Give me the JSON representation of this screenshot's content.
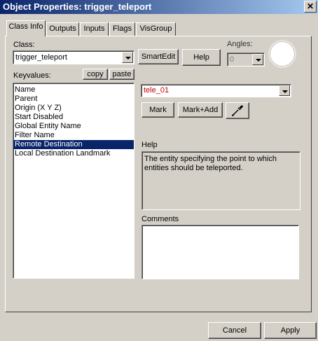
{
  "window": {
    "title": "Object Properties: trigger_teleport",
    "close_glyph": "✕"
  },
  "tabs": [
    {
      "label": "Class Info"
    },
    {
      "label": "Outputs"
    },
    {
      "label": "Inputs"
    },
    {
      "label": "Flags"
    },
    {
      "label": "VisGroup"
    }
  ],
  "class_info": {
    "class_label": "Class:",
    "class_value": "trigger_teleport",
    "smartedit_label": "SmartEdit",
    "help_button_label": "Help",
    "angles_label": "Angles:",
    "angles_value": "0",
    "keyvalues_label": "Keyvalues:",
    "copy_label": "copy",
    "paste_label": "paste",
    "keyvalues": [
      {
        "label": "Name"
      },
      {
        "label": "Parent"
      },
      {
        "label": "Origin (X Y Z)"
      },
      {
        "label": "Start Disabled"
      },
      {
        "label": "Global Entity Name"
      },
      {
        "label": "Filter Name"
      },
      {
        "label": "Remote Destination"
      },
      {
        "label": "Local Destination Landmark"
      }
    ],
    "selected_index": 6,
    "value_field": "tele_01",
    "value_color": "#c00000",
    "mark_label": "Mark",
    "markadd_label": "Mark+Add",
    "eyedropper_icon": "eyedropper-icon",
    "help_label": "Help",
    "help_text": "The entity specifying the point to which entities should be teleported.",
    "comments_label": "Comments",
    "comments_value": ""
  },
  "footer": {
    "cancel_label": "Cancel",
    "apply_label": "Apply"
  }
}
